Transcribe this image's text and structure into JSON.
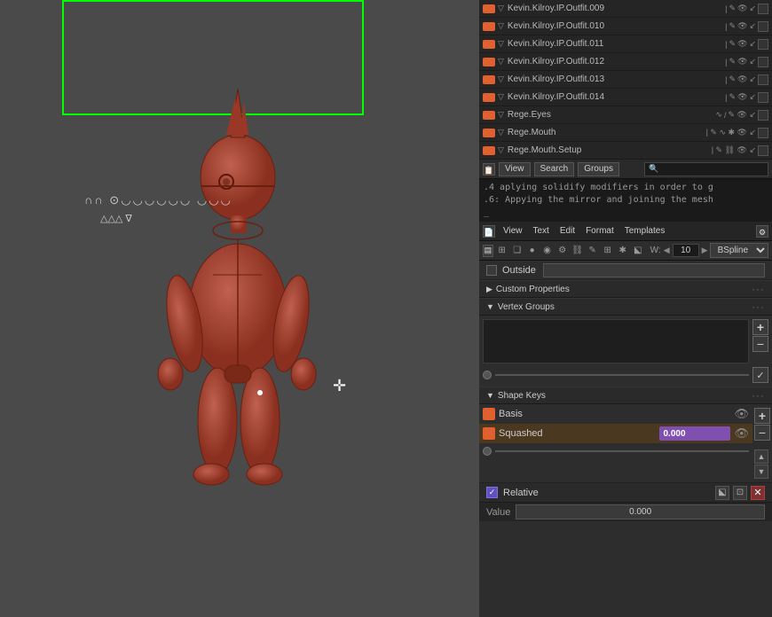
{
  "viewport": {
    "bg_color": "#4a4a4a"
  },
  "outliner": {
    "items": [
      {
        "name": "Kevin.Kilroy.IP.Outfit.009",
        "index": 9
      },
      {
        "name": "Kevin.Kilroy.IP.Outfit.010",
        "index": 10
      },
      {
        "name": "Kevin.Kilroy.IP.Outfit.011",
        "index": 11
      },
      {
        "name": "Kevin.Kilroy.IP.Outfit.012",
        "index": 12
      },
      {
        "name": "Kevin.Kilroy.IP.Outfit.013",
        "index": 13
      },
      {
        "name": "Kevin.Kilroy.IP.Outfit.014",
        "index": 14
      },
      {
        "name": "Rege.Eyes",
        "index": 15
      },
      {
        "name": "Rege.Mouth",
        "index": 16
      },
      {
        "name": "Rege.Mouth.Setup",
        "index": 17
      }
    ]
  },
  "console": {
    "line1": ".4 aplying solidify modifiers in order to g",
    "line2": ".6: Appying the mirror and joining the mesh",
    "cursor": "_",
    "header_buttons": [
      "View",
      "Search",
      "Groups"
    ],
    "search_placeholder": ""
  },
  "text_editor": {
    "header_menus": [
      "View",
      "Text",
      "Edit",
      "Format",
      "Templates"
    ],
    "w_label": "W:",
    "w_value": "10",
    "interpolation": "BSpline",
    "outside_label": "Outside"
  },
  "properties": {
    "custom_properties_label": "Custom Properties",
    "vertex_groups_label": "Vertex Groups",
    "shape_keys_label": "Shape Keys",
    "shape_keys": [
      {
        "name": "Basis",
        "value": null,
        "has_eye": true
      },
      {
        "name": "Squashed",
        "value": "0.000",
        "has_eye": true,
        "active": true
      }
    ],
    "relative_label": "Relative",
    "value_label": "Value",
    "value_value": "0.000"
  },
  "icons": {
    "add": "+",
    "remove": "−",
    "check": "✓",
    "eye": "👁",
    "arrow_right": "▶",
    "arrow_down": "▼",
    "close": "✕",
    "up": "▲",
    "down": "▼",
    "dots": "···"
  }
}
